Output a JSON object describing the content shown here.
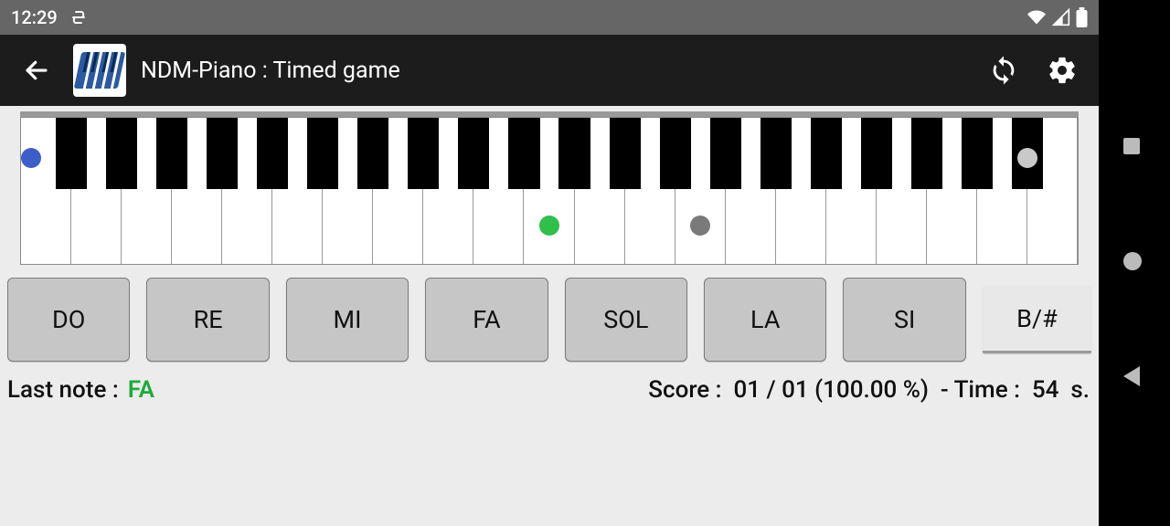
{
  "status": {
    "time": "12:29"
  },
  "app": {
    "title": "NDM-Piano : Timed game"
  },
  "piano": {
    "whiteKeys": 21,
    "blackGroups": [
      {
        "start": 0,
        "count": 2
      },
      {
        "start": 2,
        "count": 3
      },
      {
        "start": 5,
        "count": 2
      },
      {
        "start": 7,
        "count": 3
      },
      {
        "start": 10,
        "count": 2
      },
      {
        "start": 12,
        "count": 3
      },
      {
        "start": 15,
        "count": 2
      },
      {
        "start": 17,
        "count": 3
      }
    ],
    "dots": [
      {
        "type": "white",
        "index": 10,
        "color": "#2fbf4a"
      },
      {
        "type": "black",
        "group": 4,
        "sub": 2,
        "color": "#3d5ec9"
      },
      {
        "type": "white",
        "index": 13,
        "color": "#7a7a7a"
      },
      {
        "type": "black",
        "group": 7,
        "sub": 2,
        "color": "#c9c9c9"
      }
    ]
  },
  "notes": [
    "DO",
    "RE",
    "MI",
    "FA",
    "SOL",
    "LA",
    "SI"
  ],
  "accidental": "B/#",
  "last": {
    "label": "Last note :",
    "value": "FA"
  },
  "score": {
    "label": "Score :",
    "correct": "01",
    "total": "01",
    "percent": "100.00 %",
    "timeLabel": "Time :",
    "time": "54",
    "unit": "s."
  }
}
